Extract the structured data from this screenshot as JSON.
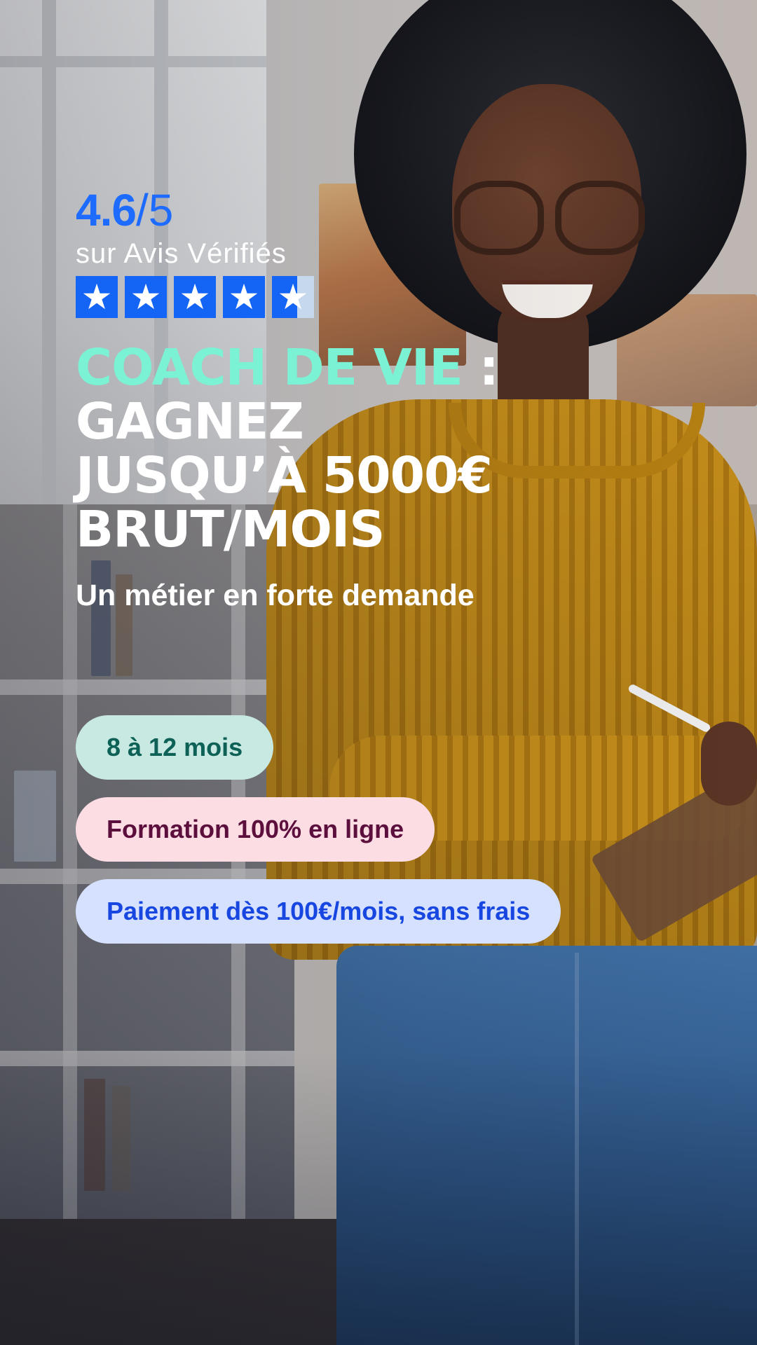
{
  "rating": {
    "value": "4.6",
    "max": "/5",
    "source": "sur Avis Vérifiés",
    "stars": 4.6,
    "star_color": "#1464f6"
  },
  "headline": {
    "accent": "COACH DE VIE",
    "accent_suffix": " :",
    "line2": "GAGNEZ",
    "line3": "JUSQU’À 5000€",
    "line4": "BRUT/MOIS",
    "accent_color": "#7bf2d3"
  },
  "subtitle": "Un métier en forte demande",
  "pills": [
    {
      "label": "8 à 12 mois",
      "bg": "#c8e9e2",
      "fg": "#0e6157"
    },
    {
      "label": "Formation 100% en ligne",
      "bg": "#fcdde4",
      "fg": "#5c0f3d"
    },
    {
      "label": "Paiement dès 100€/mois, sans frais",
      "bg": "#d5e1ff",
      "fg": "#1747e0"
    }
  ],
  "icons": [
    "star-icon"
  ]
}
